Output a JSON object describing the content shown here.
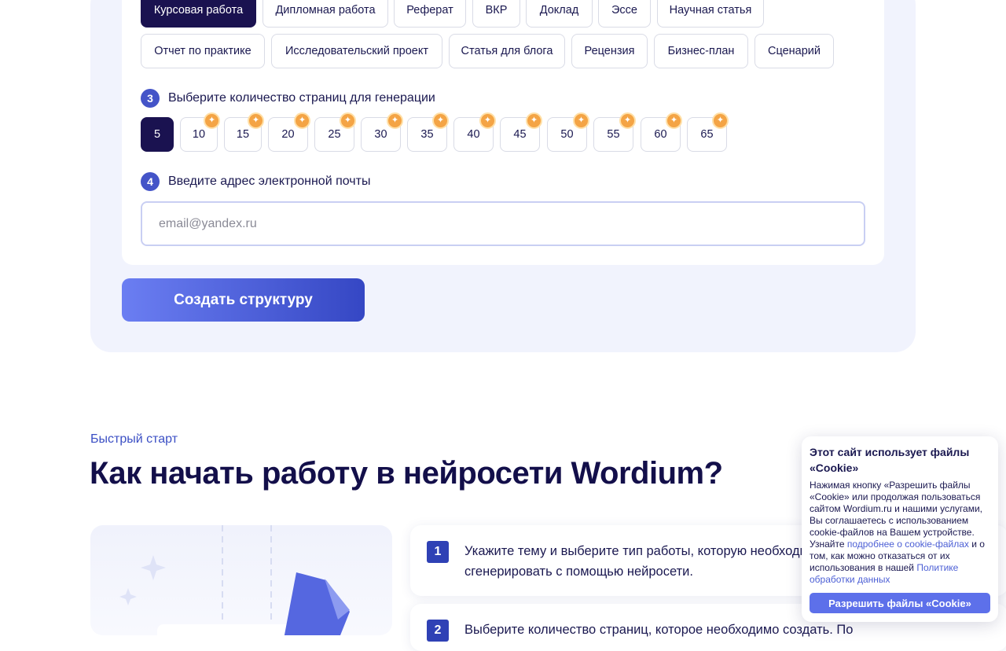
{
  "work_types_row1": [
    {
      "label": "Курсовая работа",
      "active": true
    },
    {
      "label": "Дипломная работа",
      "active": false
    },
    {
      "label": "Реферат",
      "active": false
    },
    {
      "label": "ВКР",
      "active": false
    },
    {
      "label": "Доклад",
      "active": false
    },
    {
      "label": "Эссе",
      "active": false
    },
    {
      "label": "Научная статья",
      "active": false
    }
  ],
  "work_types_row2": [
    {
      "label": "Отчет по практике"
    },
    {
      "label": "Исследовательский проект"
    },
    {
      "label": "Статья для блога"
    },
    {
      "label": "Рецензия"
    },
    {
      "label": "Бизнес-план"
    },
    {
      "label": "Сценарий"
    }
  ],
  "step3": {
    "number": "3",
    "label": "Выберите количество страниц для генерации"
  },
  "pages": {
    "options": [
      "5",
      "10",
      "15",
      "20",
      "25",
      "30",
      "35",
      "40",
      "45",
      "50",
      "55",
      "60",
      "65"
    ],
    "selected": "5",
    "premium_icon": "sparkle-icon",
    "premium_color": "#f4a445"
  },
  "step4": {
    "number": "4",
    "label": "Введите адрес электронной почты"
  },
  "email": {
    "placeholder": "email@yandex.ru",
    "value": ""
  },
  "create_button": "Создать структуру",
  "quick_start": {
    "eyebrow": "Быстрый старт",
    "heading": "Как начать работу в нейросети Wordium?",
    "steps": [
      {
        "number": "1",
        "line1": "Укажите тему и выберите тип работы, которую необходимо",
        "line2": "сгенерировать с помощью нейросети."
      },
      {
        "number": "2",
        "line1": "Выберите количество страниц, которое необходимо создать. По",
        "line2": ""
      }
    ]
  },
  "cookie": {
    "title": "Этот сайт использует файлы «Cookie»",
    "text_part1": "Нажимая кнопку «Разрешить файлы «Cookie» или продолжая пользоваться сайтом Wordium.ru и нашими услугами, Вы соглашаетесь с использованием cookie-файлов на Вашем устройстве. Узнайте ",
    "link1": "подробнее о cookie-файлах",
    "text_part2": " и о том, как можно отказаться от их использования в нашей ",
    "link2": "Политике обработки данных",
    "button": "Разрешить файлы «Cookie»"
  },
  "colors": {
    "accent": "#4454c8",
    "active_chip": "#1a1250",
    "heading": "#130f4a",
    "link": "#4c5fd5"
  }
}
